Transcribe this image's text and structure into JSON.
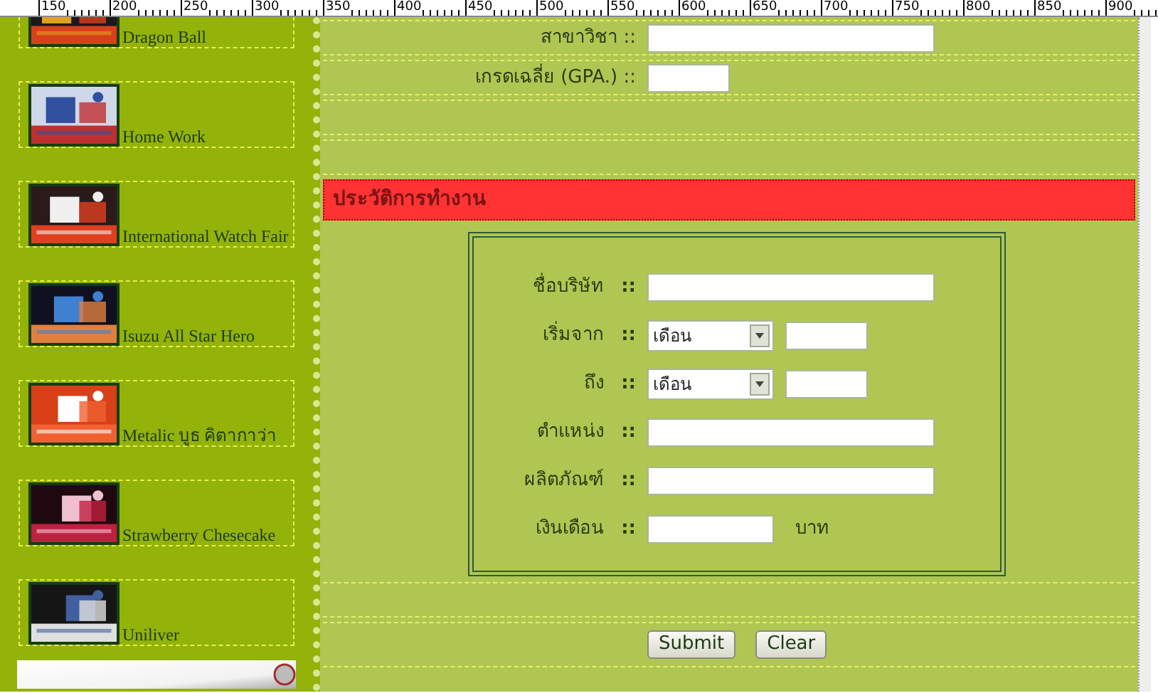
{
  "ruler": {
    "labels": [
      "150",
      "200",
      "250",
      "300",
      "350",
      "400",
      "450",
      "500",
      "550",
      "600",
      "650",
      "700",
      "750",
      "800",
      "850",
      "900"
    ]
  },
  "sidebar": {
    "items": [
      {
        "name": "Dragon Ball"
      },
      {
        "name": "Home Work"
      },
      {
        "name": "International Watch Fair"
      },
      {
        "name": "Isuzu All Star Hero"
      },
      {
        "name": "Metalic บูธ คิตากาว่า"
      },
      {
        "name": "Strawberry Chesecake"
      },
      {
        "name": "Uniliver"
      }
    ]
  },
  "education_fields": [
    {
      "label": "สาขาวิชา",
      "separator": "::",
      "kind": "wide"
    },
    {
      "label": "เกรดเฉลี่ย (GPA.)",
      "separator": "::",
      "kind": "short"
    }
  ],
  "section_header": "ประวัติการทำงาน",
  "work_fields": [
    {
      "label": "ชื่อบริษัท",
      "separator": "::",
      "kind": "text"
    },
    {
      "label": "เริ่มจาก",
      "separator": "::",
      "kind": "month-year",
      "select_value": "เดือน"
    },
    {
      "label": "ถึง",
      "separator": "::",
      "kind": "month-year",
      "select_value": "เดือน"
    },
    {
      "label": "ตำแหน่ง",
      "separator": "::",
      "kind": "text"
    },
    {
      "label": "ผลิตภัณฑ์",
      "separator": "::",
      "kind": "text"
    },
    {
      "label": "เงินเดือน",
      "separator": "::",
      "kind": "amount",
      "unit": "บาท"
    }
  ],
  "buttons": [
    "Submit",
    "Clear"
  ]
}
